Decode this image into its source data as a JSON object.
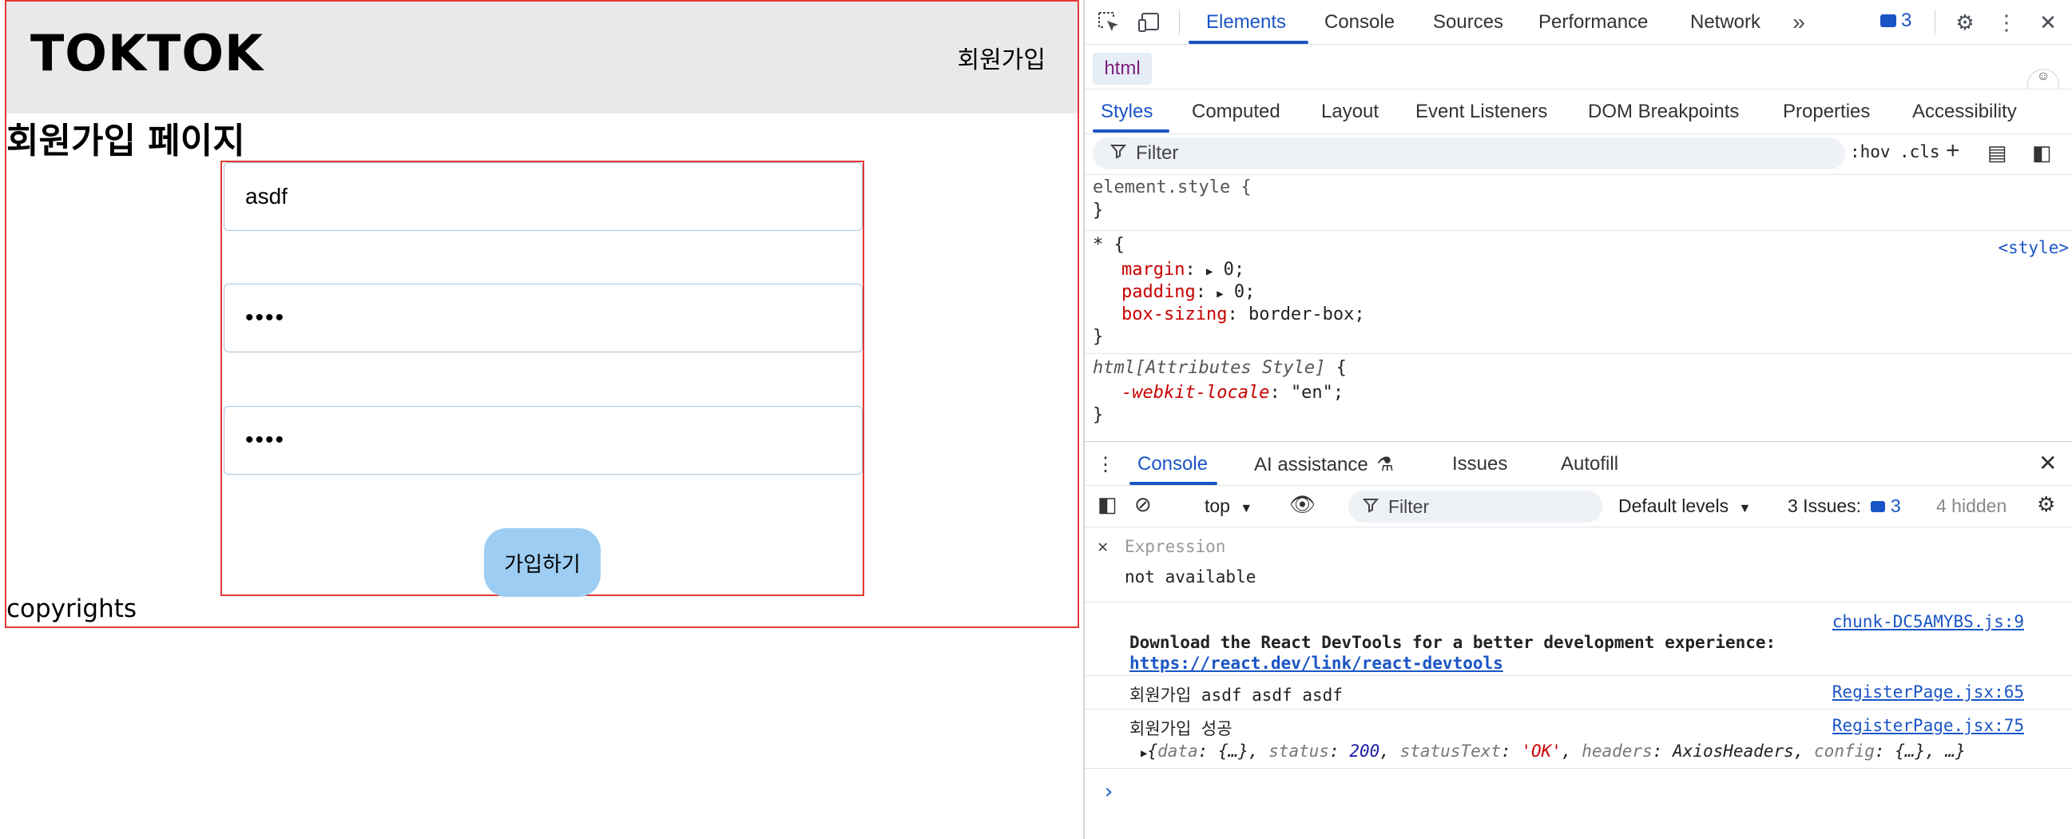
{
  "app": {
    "logo": "TOKTOK",
    "header_link": "회원가입",
    "page_title": "회원가입 페이지",
    "form": {
      "username_value": "asdf",
      "password_value": "••••",
      "password_confirm_value": "••••",
      "submit_label": "가입하기"
    },
    "footer": "copyrights"
  },
  "devtools": {
    "top_tabs": [
      "Elements",
      "Console",
      "Sources",
      "Performance",
      "Network"
    ],
    "more_tabs_icon": "chevron-double-right-icon",
    "issues_count": "3",
    "breadcrumb": "html",
    "style_tabs": [
      "Styles",
      "Computed",
      "Layout",
      "Event Listeners",
      "DOM Breakpoints",
      "Properties",
      "Accessibility"
    ],
    "styles_filter_placeholder": "Filter",
    "hov_label": ":hov",
    "cls_label": ".cls",
    "rules": {
      "element_style_open": "element.style {",
      "close_brace": "}",
      "star_selector": "* {",
      "star_origin": "<style>",
      "margin_prop": "margin",
      "margin_val": "0;",
      "padding_prop": "padding",
      "padding_val": "0;",
      "box_sizing_prop": "box-sizing",
      "box_sizing_val": "border-box;",
      "html_attr_selector": "html[Attributes Style]",
      "html_attr_open": " {",
      "webkit_locale_prop": "-webkit-locale",
      "webkit_locale_val": "\"en\";"
    },
    "console_tabs": [
      "Console",
      "AI assistance",
      "Issues",
      "Autofill"
    ],
    "console_toolbar": {
      "context": "top",
      "filter_placeholder": "Filter",
      "levels": "Default levels",
      "issues_label": "3 Issues:",
      "issues_count": "3",
      "hidden": "4 hidden"
    },
    "expression": {
      "placeholder": "Expression",
      "value": "not available"
    },
    "logs": [
      {
        "source": "chunk-DC5AMYBS.js:9",
        "line1": "Download the React DevTools for a better development experience:",
        "line2": "https://react.dev/link/react-devtools"
      },
      {
        "source": "RegisterPage.jsx:65",
        "text": "회원가입 asdf asdf asdf"
      },
      {
        "source": "RegisterPage.jsx:75",
        "text": "회원가입 성공",
        "object_open": "{",
        "k_data": "data",
        "v_data": "{…}",
        "k_status": "status",
        "v_status": "200",
        "k_statusText": "statusText",
        "v_statusText": "'OK'",
        "k_headers": "headers",
        "v_headers": "AxiosHeaders",
        "k_config": "config",
        "v_config": "{…}",
        "tail": "…}"
      }
    ],
    "prompt": "›"
  }
}
